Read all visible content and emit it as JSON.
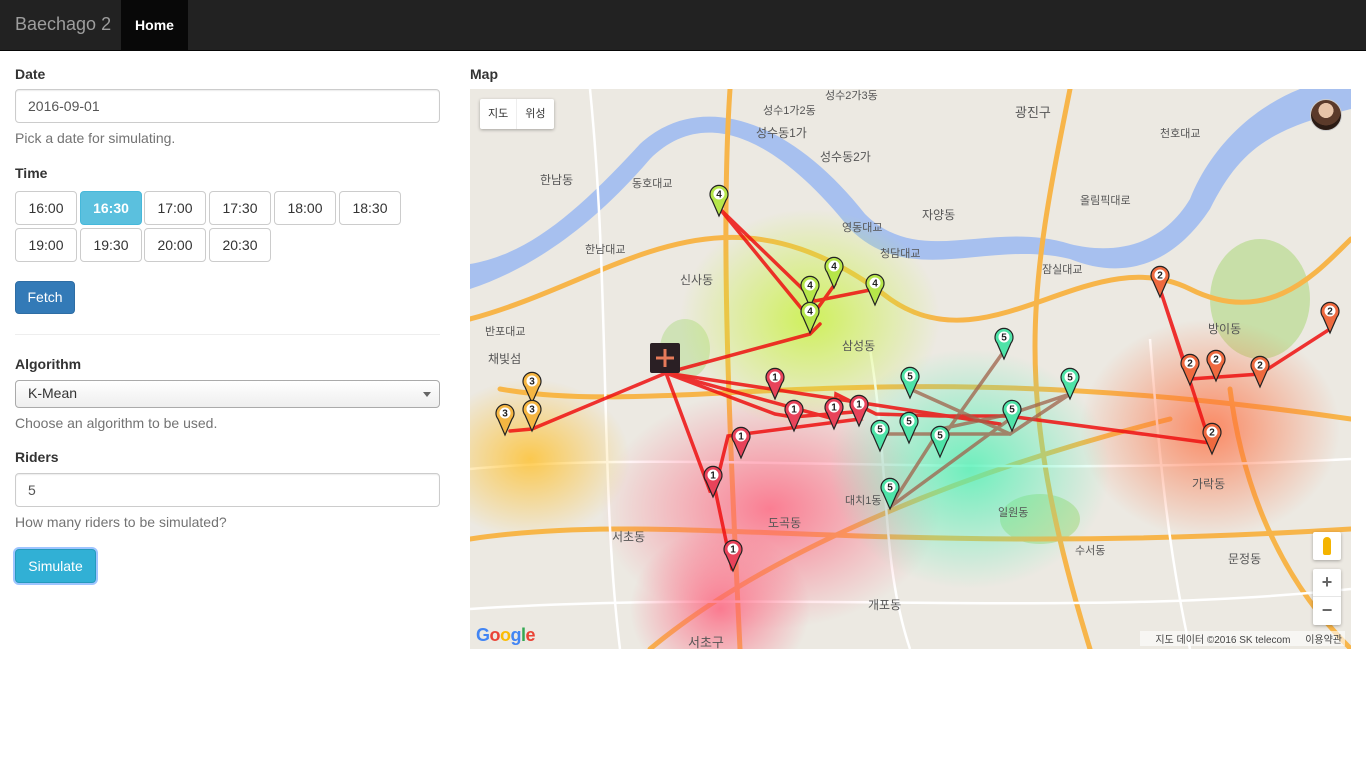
{
  "navbar": {
    "brand": "Baechago 2",
    "home": "Home"
  },
  "form": {
    "date_label": "Date",
    "date_value": "2016-09-01",
    "date_help": "Pick a date for simulating.",
    "time_label": "Time",
    "times": [
      "16:00",
      "16:30",
      "17:00",
      "17:30",
      "18:00",
      "18:30",
      "19:00",
      "19:30",
      "20:00",
      "20:30"
    ],
    "selected_time": "16:30",
    "fetch_label": "Fetch",
    "algorithm_label": "Algorithm",
    "algorithm_value": "K-Mean",
    "algorithm_help": "Choose an algorithm to be used.",
    "riders_label": "Riders",
    "riders_value": "5",
    "riders_help": "How many riders to be simulated?",
    "simulate_label": "Simulate"
  },
  "map": {
    "label": "Map",
    "type_map": "지도",
    "type_satellite": "위성",
    "google_logo": "Google",
    "attribution": "지도 데이터 ©2016 SK telecom",
    "terms": "이용약관",
    "zoom_in": "+",
    "zoom_out": "−",
    "place_labels": [
      "성수1가2동",
      "성수2가3동",
      "광진구",
      "성수동1가",
      "성수동2가",
      "한남동",
      "동호대교",
      "자양동",
      "영동대교",
      "청담대교",
      "한남대교",
      "신사동",
      "반포대교",
      "채빛섬",
      "삼성동",
      "잠실대교",
      "방이동",
      "천호대교",
      "올림픽대로",
      "가락동",
      "문정동",
      "도곡동",
      "서초동",
      "개포동",
      "일원동",
      "수서동",
      "대치1동",
      "서초구"
    ]
  },
  "markers": [
    {
      "cluster": "1",
      "color": "#e8435a"
    },
    {
      "cluster": "2",
      "color": "#ef6a3f"
    },
    {
      "cluster": "3",
      "color": "#f5b642"
    },
    {
      "cluster": "4",
      "color": "#b6e64a"
    },
    {
      "cluster": "5",
      "color": "#4fe3a8"
    }
  ]
}
